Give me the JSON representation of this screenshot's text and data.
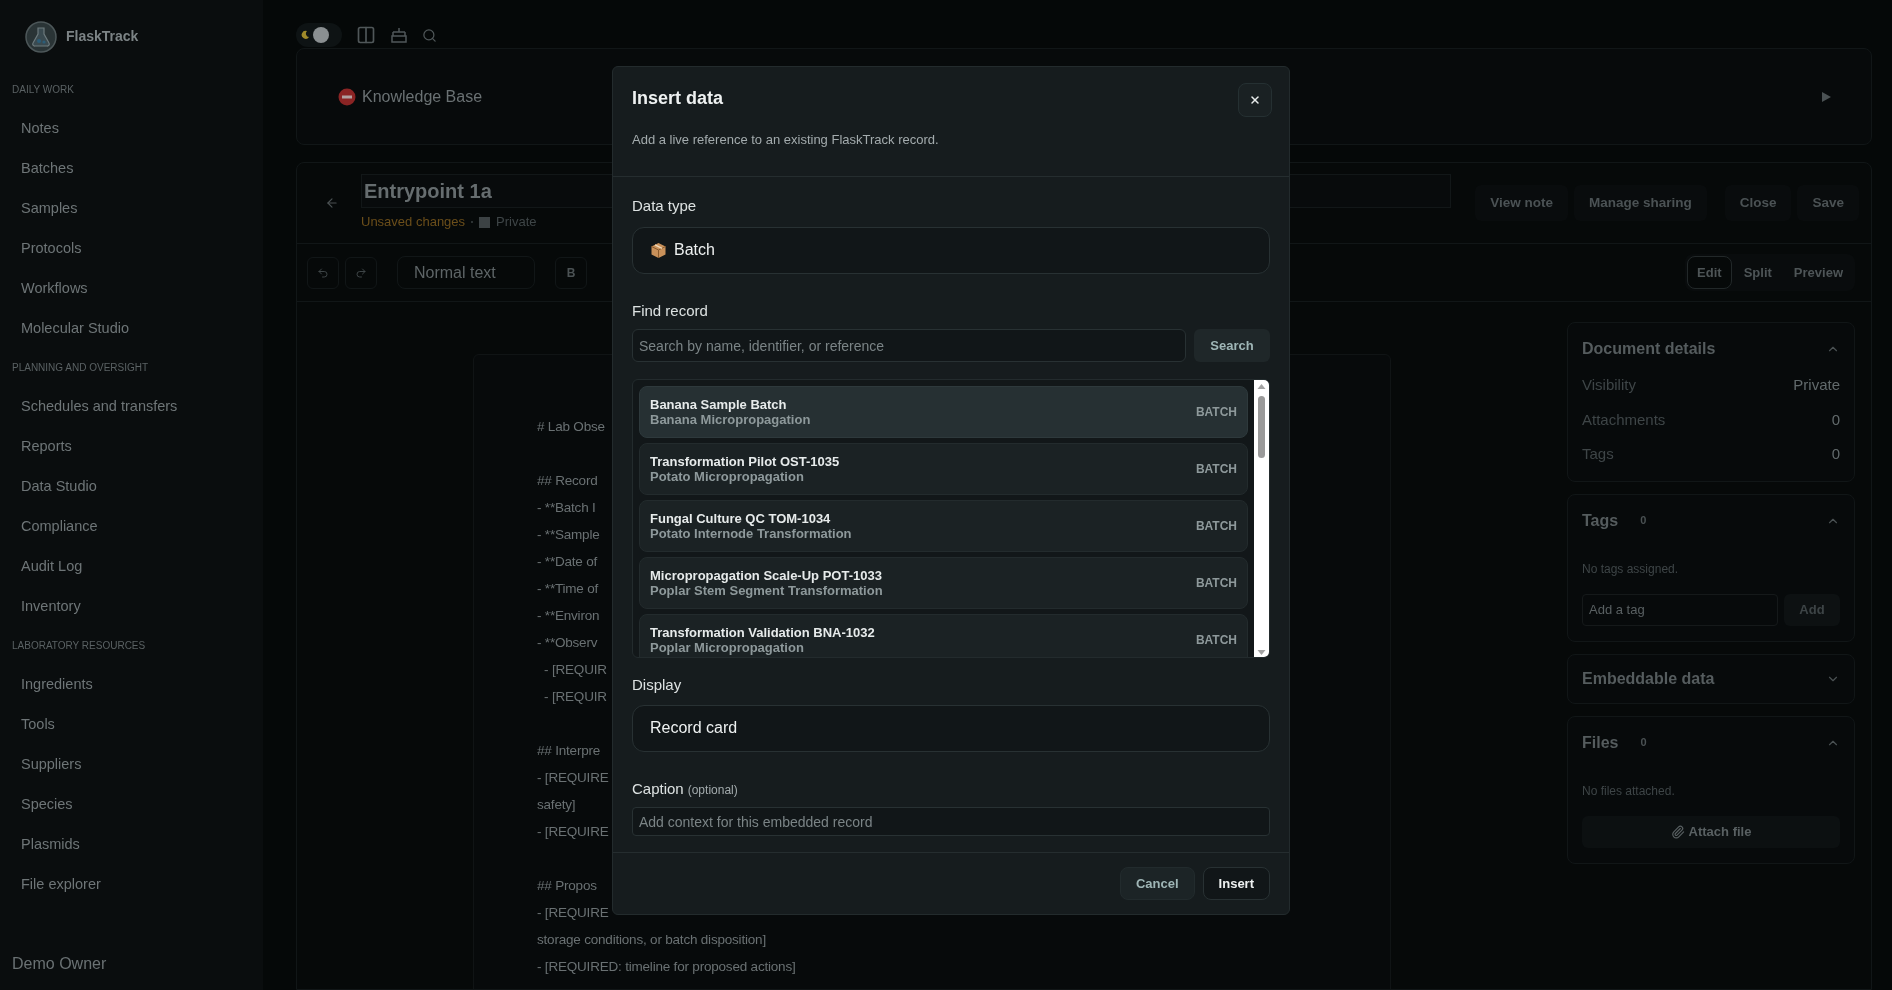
{
  "brand": "FlaskTrack",
  "sidebar": {
    "sections": [
      {
        "heading": "DAILY WORK",
        "items": [
          "Notes",
          "Batches",
          "Samples",
          "Protocols",
          "Workflows",
          "Molecular Studio"
        ]
      },
      {
        "heading": "PLANNING AND OVERSIGHT",
        "items": [
          "Schedules and transfers",
          "Reports",
          "Data Studio",
          "Compliance",
          "Audit Log",
          "Inventory"
        ]
      },
      {
        "heading": "LABORATORY RESOURCES",
        "items": [
          "Ingredients",
          "Tools",
          "Suppliers",
          "Species",
          "Plasmids",
          "File explorer"
        ]
      }
    ],
    "user": "Demo Owner"
  },
  "theme_toggle": {
    "on": true
  },
  "breadcrumb": {
    "label": "Knowledge Base"
  },
  "note": {
    "title": "Entrypoint 1a",
    "status": "Unsaved changes",
    "visibility": "Private",
    "actions": [
      "View note",
      "Manage sharing",
      "Close",
      "Save"
    ]
  },
  "editor_toolbar": {
    "block_style": "Normal text",
    "bold": "B",
    "modes": [
      {
        "label": "Edit",
        "selected": true
      },
      {
        "label": "Split",
        "selected": false
      },
      {
        "label": "Preview",
        "selected": false
      }
    ]
  },
  "document": [
    [
      "# Lab Obse"
    ],
    [
      "## Record",
      "- **Batch I",
      "- **Sample",
      "- **Date of",
      "- **Time of",
      "- **Environ",
      "- **Observ",
      "  - [REQUIR",
      "  - [REQUIR"
    ],
    [
      "## Interpre",
      "- [REQUIRE",
      "safety]",
      "- [REQUIRE"
    ],
    [
      "## Propos",
      "- [REQUIRE",
      "storage conditions, or batch disposition]",
      "- [REQUIRED: timeline for proposed actions]"
    ]
  ],
  "details_panel": [
    {
      "kind": "details",
      "title": "Document details",
      "expanded": true,
      "rows": [
        {
          "label": "Visibility",
          "value": "Private"
        },
        {
          "label": "Attachments",
          "value": "0"
        },
        {
          "label": "Tags",
          "value": "0"
        }
      ]
    },
    {
      "kind": "tags",
      "title": "Tags",
      "count": "0",
      "expanded": true,
      "empty_text": "No tags assigned.",
      "placeholder": "Add a tag",
      "button": "Add"
    },
    {
      "kind": "plain",
      "title": "Embeddable data",
      "expanded": false
    },
    {
      "kind": "files",
      "title": "Files",
      "count": "0",
      "expanded": true,
      "empty_text": "No files attached.",
      "button": "Attach file"
    }
  ],
  "dialog": {
    "title": "Insert data",
    "subtitle": "Add a live reference to an existing FlaskTrack record.",
    "data_type": {
      "label": "Data type",
      "value": "Batch"
    },
    "find": {
      "label": "Find record",
      "placeholder": "Search by name, identifier, or reference",
      "button": "Search"
    },
    "records": [
      {
        "name": "Banana Sample Batch",
        "project": "Banana Micropropagation",
        "type": "BATCH",
        "selected": true
      },
      {
        "name": "Transformation Pilot OST-1035",
        "project": "Potato Micropropagation",
        "type": "BATCH",
        "selected": false
      },
      {
        "name": "Fungal Culture QC TOM-1034",
        "project": "Potato Internode Transformation",
        "type": "BATCH",
        "selected": false
      },
      {
        "name": "Micropropagation Scale-Up POT-1033",
        "project": "Poplar Stem Segment Transformation",
        "type": "BATCH",
        "selected": false
      },
      {
        "name": "Transformation Validation BNA-1032",
        "project": "Poplar Micropropagation",
        "type": "BATCH",
        "selected": false
      }
    ],
    "display": {
      "label": "Display",
      "value": "Record card"
    },
    "caption": {
      "label": "Caption",
      "hint": "(optional)",
      "placeholder": "Add context for this embedded record"
    },
    "buttons": [
      "Cancel",
      "Insert"
    ]
  }
}
